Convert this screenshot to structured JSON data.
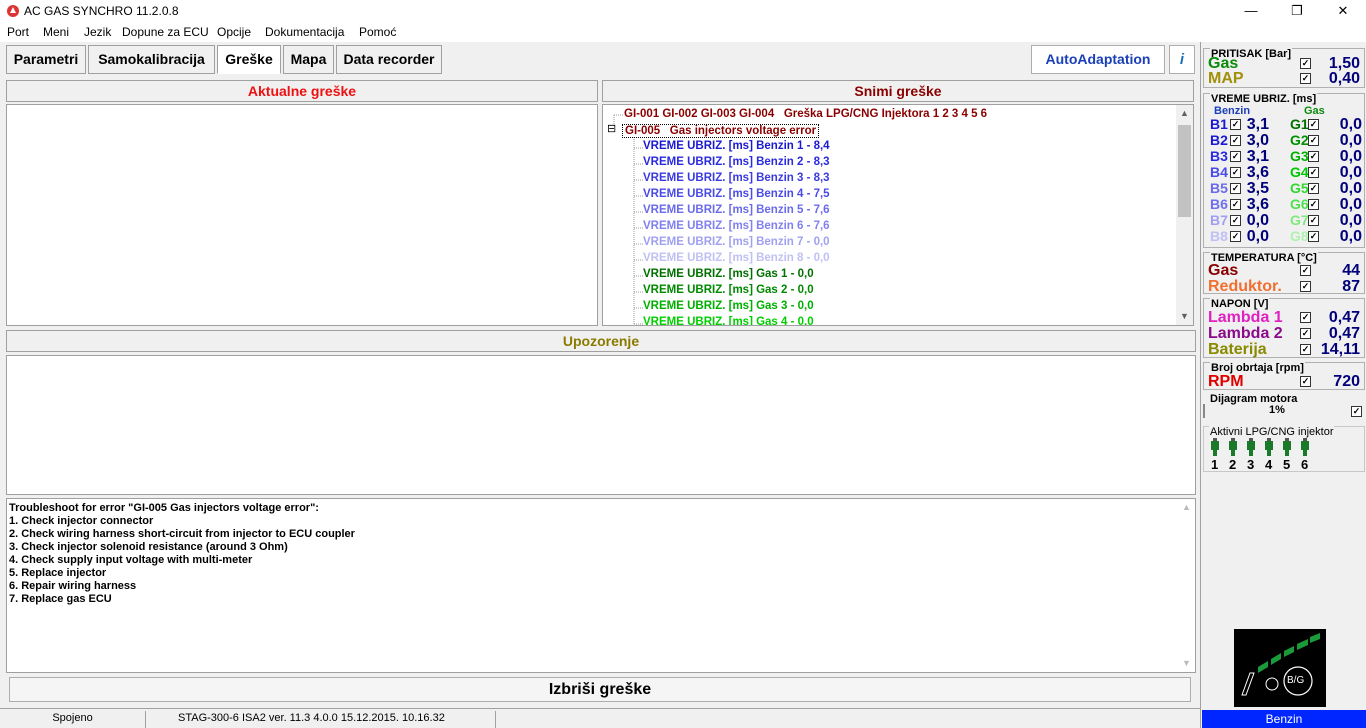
{
  "window": {
    "title": "AC GAS SYNCHRO  11.2.0.8",
    "minimize": "—",
    "maximize": "❐",
    "close": "✕"
  },
  "menu": [
    "Port",
    "Meni",
    "Jezik",
    "Dopune za ECU",
    "Opcije",
    "Dokumentacija",
    "Pomoć"
  ],
  "tabs": [
    "Parametri",
    "Samokalibracija",
    "Greške",
    "Mapa",
    "Data recorder"
  ],
  "active_tab": "Greške",
  "toolbar": {
    "autoadapt_label": "AutoAdaptation",
    "info_label": "i"
  },
  "current_errors": {
    "title": "Aktualne greške"
  },
  "snapshots": {
    "title": "Snimi greške",
    "root1": {
      "code": "GI-001 GI-002 GI-003 GI-004",
      "text": "Greška LPG/CNG Injektora 1 2 3 4 5 6"
    },
    "root2": {
      "toggle": "⊟",
      "code": "GI-005",
      "text": "Gas injectors voltage error"
    },
    "children": [
      {
        "text": "VREME UBRIZ. [ms] Benzin 1 - 8,4",
        "color": "#1a1ad0"
      },
      {
        "text": "VREME UBRIZ. [ms] Benzin 2 - 8,3",
        "color": "#2a2ae0"
      },
      {
        "text": "VREME UBRIZ. [ms] Benzin 3 - 8,3",
        "color": "#3a3ae0"
      },
      {
        "text": "VREME UBRIZ. [ms] Benzin 4 - 7,5",
        "color": "#4a4ae6"
      },
      {
        "text": "VREME UBRIZ. [ms] Benzin 5 - 7,6",
        "color": "#6a6aea"
      },
      {
        "text": "VREME UBRIZ. [ms] Benzin 6 - 7,6",
        "color": "#8080f0"
      },
      {
        "text": "VREME UBRIZ. [ms] Benzin 7 - 0,0",
        "color": "#a0a0f0"
      },
      {
        "text": "VREME UBRIZ. [ms] Benzin 8 - 0,0",
        "color": "#c0c0f4"
      },
      {
        "text": "VREME UBRIZ. [ms] Gas 1 - 0,0",
        "color": "#007000"
      },
      {
        "text": "VREME UBRIZ. [ms] Gas 2 - 0,0",
        "color": "#008a00"
      },
      {
        "text": "VREME UBRIZ. [ms] Gas 3 - 0,0",
        "color": "#00b000"
      },
      {
        "text": "VREME UBRIZ. [ms] Gas 4 - 0,0",
        "color": "#00d000"
      }
    ]
  },
  "warning": {
    "title": "Upozorenje"
  },
  "troubleshoot": [
    "Troubleshoot for error \"GI-005   Gas injectors voltage error\":",
    "1. Check injector connector",
    "2. Check wiring harness short-circuit from injector to ECU coupler",
    "3. Check injector solenoid resistance (around 3 Ohm)",
    "4. Check supply input voltage with multi-meter",
    "5. Replace injector",
    "6. Repair wiring harness",
    "7. Replace gas ECU"
  ],
  "clear_button": "Izbriši greške",
  "status": {
    "connection": "Spojeno",
    "device": "STAG-300-6 ISA2   ver. 11.3  4.0.0    15.12.2015. 10.16.32"
  },
  "right": {
    "pressure": {
      "title": "PRITISAK [Bar]",
      "gas_label": "Gas",
      "gas_value": "1,50",
      "map_label": "MAP",
      "map_value": "0,40"
    },
    "injection": {
      "title": "VREME UBRIZ. [ms]",
      "benzin_header": "Benzin",
      "gas_header": "Gas",
      "benzin": [
        [
          "B1",
          "3,1"
        ],
        [
          "B2",
          "3,0"
        ],
        [
          "B3",
          "3,1"
        ],
        [
          "B4",
          "3,6"
        ],
        [
          "B5",
          "3,5"
        ],
        [
          "B6",
          "3,6"
        ],
        [
          "B7",
          "0,0"
        ],
        [
          "B8",
          "0,0"
        ]
      ],
      "gas": [
        [
          "G1",
          "0,0"
        ],
        [
          "G2",
          "0,0"
        ],
        [
          "G3",
          "0,0"
        ],
        [
          "G4",
          "0,0"
        ],
        [
          "G5",
          "0,0"
        ],
        [
          "G6",
          "0,0"
        ],
        [
          "G7",
          "0,0"
        ],
        [
          "G8",
          "0,0"
        ]
      ]
    },
    "temperature": {
      "title": "TEMPERATURA  [°C]",
      "gas_label": "Gas",
      "gas_value": "44",
      "red_label": "Reduktor.",
      "red_value": "87"
    },
    "voltage": {
      "title": "NAPON [V]",
      "l1_label": "Lambda 1",
      "l1_value": "0,47",
      "l2_label": "Lambda 2",
      "l2_value": "0,47",
      "bat_label": "Baterija",
      "bat_value": "14,11"
    },
    "rpm": {
      "title": "Broj obrtaja [rpm]",
      "label": "RPM",
      "value": "720"
    },
    "diagram": {
      "title": "Dijagram motora",
      "value": "1%"
    },
    "active_inj": {
      "title": "Aktivni LPG/CNG injektor",
      "numbers": [
        "1",
        "2",
        "3",
        "4",
        "5",
        "6"
      ]
    },
    "fuel_state": "Benzin",
    "logo_text": "B/G",
    "check": "✓"
  }
}
